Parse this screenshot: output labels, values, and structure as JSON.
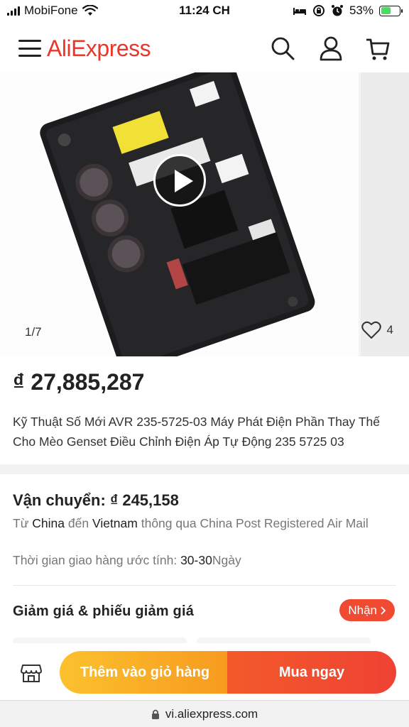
{
  "status_bar": {
    "carrier": "MobiFone",
    "time": "11:24 CH",
    "battery": "53%",
    "battery_level": 0.53,
    "icons": [
      "signal-icon",
      "wifi-icon",
      "bed-icon",
      "lock-rotation-icon",
      "alarm-icon",
      "battery-charging-icon"
    ]
  },
  "header": {
    "logo": "AliExpress",
    "icons": [
      "menu-icon",
      "search-icon",
      "account-icon",
      "cart-icon"
    ]
  },
  "gallery": {
    "counter": "1/7",
    "wishlist_count": "4",
    "icons": [
      "play-icon",
      "heart-icon"
    ]
  },
  "product": {
    "price": "₫ 27,885,287",
    "title": "Kỹ Thuật Số Mới AVR 235-5725-03 Máy Phát Điện Phần Thay Thế Cho Mèo Genset Điều Chỉnh Điện Áp Tự Động 235 5725 03"
  },
  "shipping": {
    "label": "Vận chuyển:",
    "cost": "₫ 245,158",
    "from_word": "Từ",
    "from": "China",
    "to_word": "đến",
    "to": "Vietnam",
    "via": "thông qua China Post Registered Air Mail",
    "eta_label": "Thời gian giao hàng ước tính:",
    "eta_value": "30-30",
    "eta_unit": "Ngày"
  },
  "coupons": {
    "title": "Giảm giá & phiếu giảm giá",
    "button": "Nhận"
  },
  "actions": {
    "add_to_cart": "Thêm vào giỏ hàng",
    "buy_now": "Mua ngay",
    "icons": [
      "store-icon"
    ]
  },
  "browser": {
    "url": "vi.aliexpress.com",
    "icons": [
      "lock-icon"
    ]
  },
  "colors": {
    "brand": "#e8372c",
    "cart_button": "#fcc12d",
    "buy_button": "#ef4234"
  }
}
